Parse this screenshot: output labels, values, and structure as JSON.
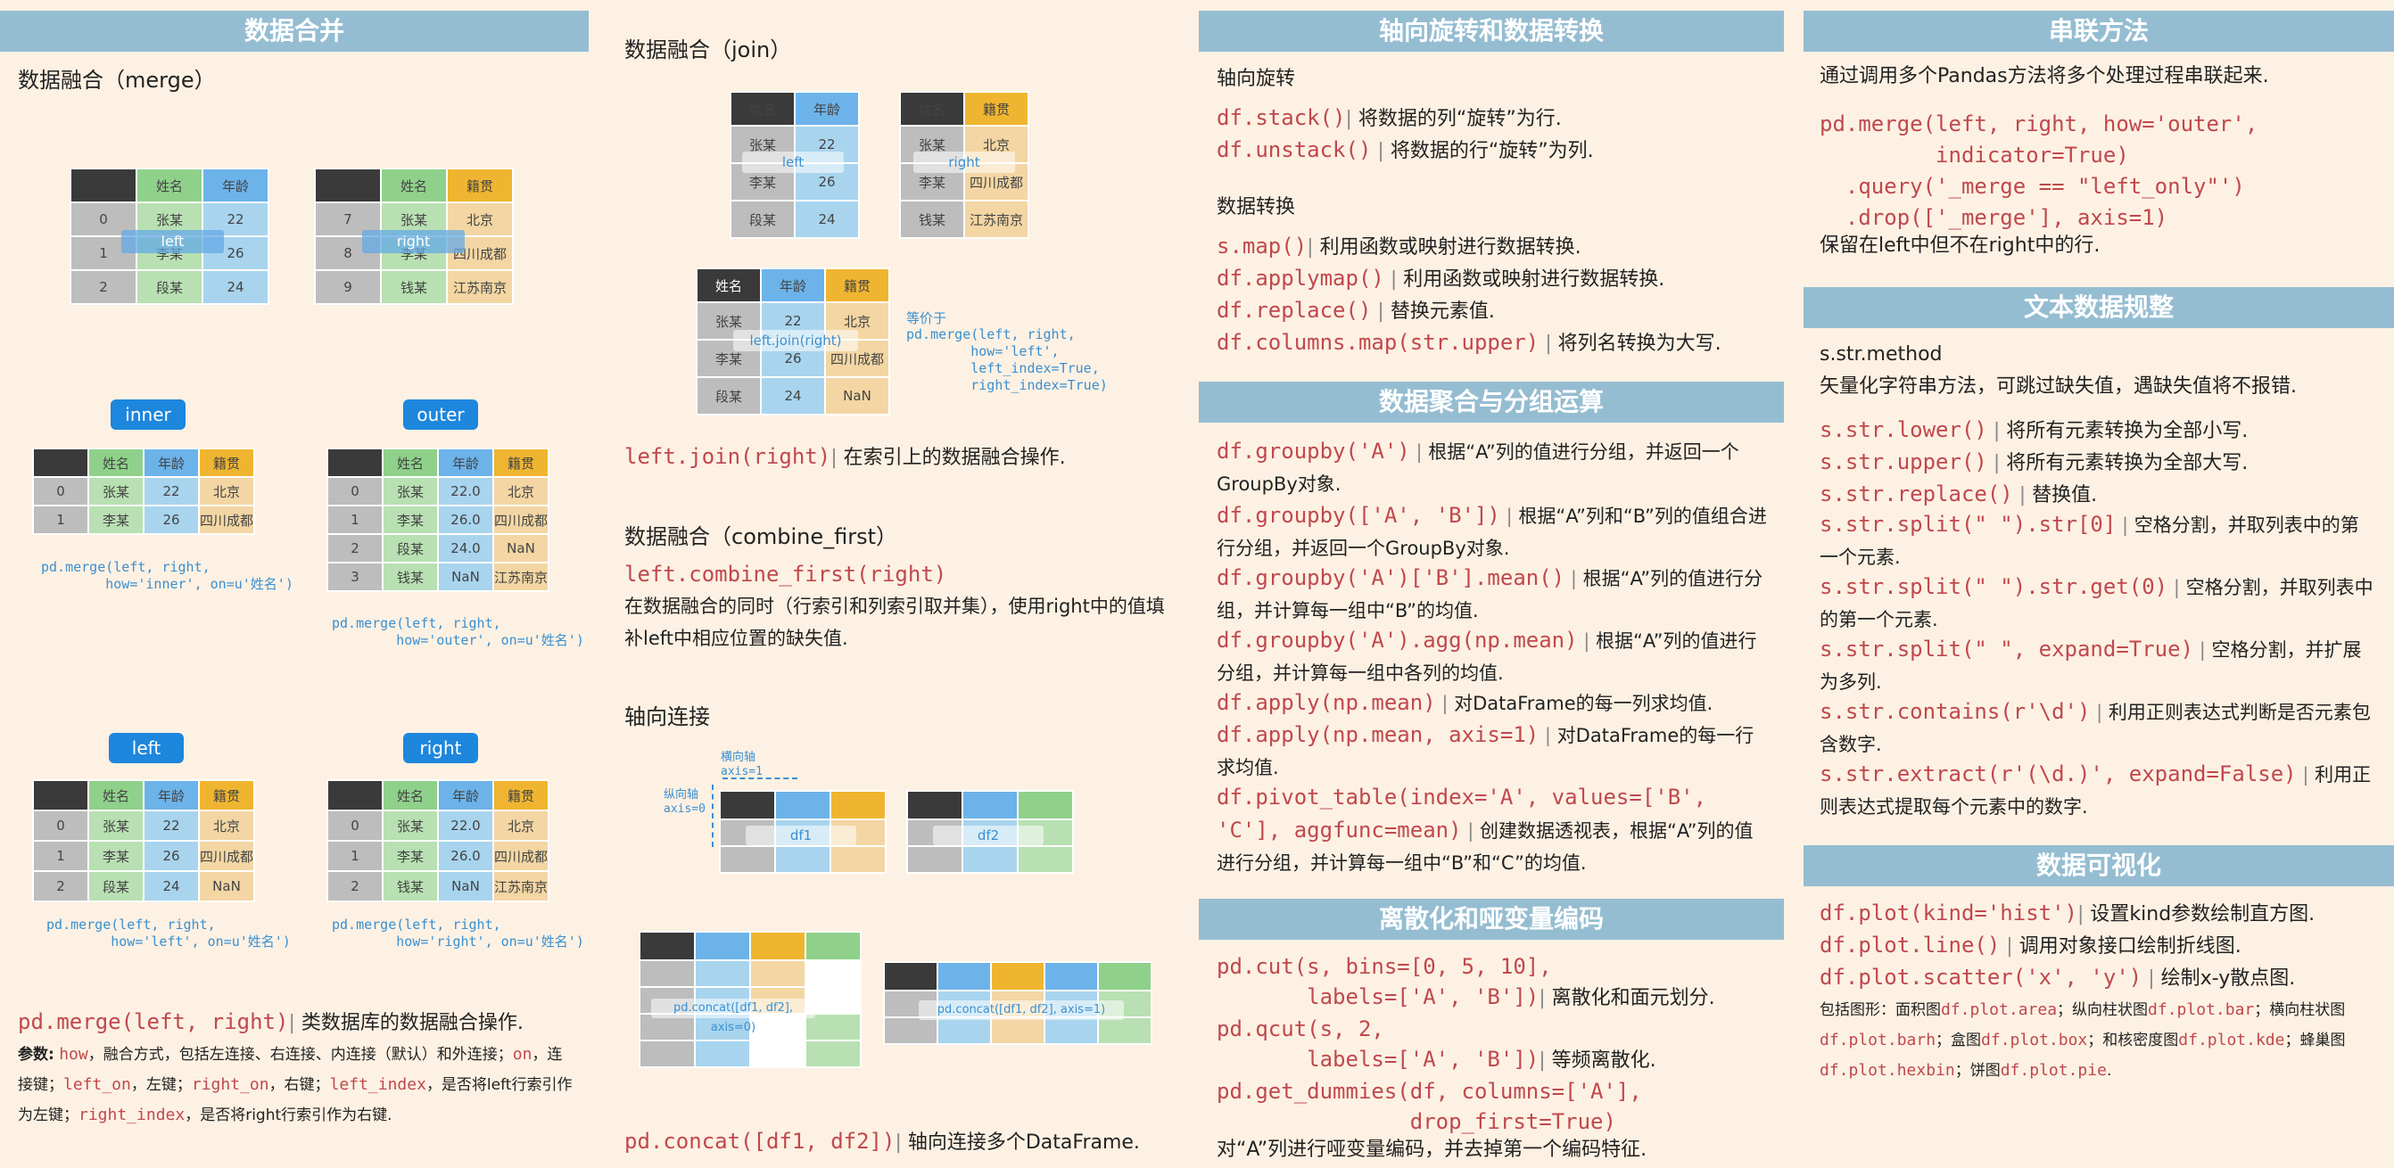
{
  "col1": {
    "header": "数据合并",
    "merge_title": "数据融合（merge）",
    "tbl_headers": [
      "姓名",
      "年龄",
      "籍贯"
    ],
    "left_rows": [
      [
        "0",
        "张某",
        "22"
      ],
      [
        "1",
        "李某",
        "26"
      ],
      [
        "2",
        "段某",
        "24"
      ]
    ],
    "right_rows": [
      [
        "7",
        "张某",
        "北京"
      ],
      [
        "8",
        "李某",
        "四川成都"
      ],
      [
        "9",
        "钱某",
        "江苏南京"
      ]
    ],
    "label_left": "left",
    "label_right": "right",
    "inner_label": "inner",
    "outer_label": "outer",
    "left_label": "left",
    "right_label": "right",
    "inner_rows": [
      [
        "0",
        "张某",
        "22",
        "北京"
      ],
      [
        "1",
        "李某",
        "26",
        "四川成都"
      ]
    ],
    "outer_rows": [
      [
        "0",
        "张某",
        "22.0",
        "北京"
      ],
      [
        "1",
        "李某",
        "26.0",
        "四川成都"
      ],
      [
        "2",
        "段某",
        "24.0",
        "NaN"
      ],
      [
        "3",
        "钱某",
        "NaN",
        "江苏南京"
      ]
    ],
    "lefth_rows": [
      [
        "0",
        "张某",
        "22",
        "北京"
      ],
      [
        "1",
        "李某",
        "26",
        "四川成都"
      ],
      [
        "2",
        "段某",
        "24",
        "NaN"
      ]
    ],
    "righth_rows": [
      [
        "0",
        "张某",
        "22.0",
        "北京"
      ],
      [
        "1",
        "李某",
        "26.0",
        "四川成都"
      ],
      [
        "2",
        "钱某",
        "NaN",
        "江苏南京"
      ]
    ],
    "inner_cap": "pd.merge(left, right,\n        how='inner', on=u'姓名')",
    "outer_cap": "pd.merge(left, right,\n        how='outer', on=u'姓名')",
    "left_cap": "pd.merge(left, right,\n        how='left', on=u'姓名')",
    "right_cap": "pd.merge(left, right,\n        how='right', on=u'姓名')",
    "merge_code": "pd.merge(left, right)",
    "merge_desc": "类数据库的数据融合操作.",
    "params_label": "参数:",
    "p_how": "how",
    "p_how_desc": "，融合方式，包括左连接、右连接、内连接（默认）和外连接；",
    "p_on": "on",
    "p_on_desc": "，连接键；",
    "p_left_on": "left_on",
    "p_left_on_desc": "，左键；",
    "p_right_on": "right_on",
    "p_right_on_desc": "，右键；",
    "p_left_index": "left_index",
    "p_left_index_desc": "，是否将left行索引作为左键；",
    "p_right_index": "right_index",
    "p_right_index_desc": "，是否将right行索引作为右键."
  },
  "col2": {
    "join_title": "数据融合（join）",
    "join_left_rows": [
      [
        "张某",
        "22"
      ],
      [
        "李某",
        "26"
      ],
      [
        "段某",
        "24"
      ]
    ],
    "join_right_rows": [
      [
        "张某",
        "北京"
      ],
      [
        "李某",
        "四川成都"
      ],
      [
        "钱某",
        "江苏南京"
      ]
    ],
    "join_res_rows": [
      [
        "张某",
        "22",
        "北京"
      ],
      [
        "李某",
        "26",
        "四川成都"
      ],
      [
        "段某",
        "24",
        "NaN"
      ]
    ],
    "join_ovl": "left.join(right)",
    "join_note1": "等价于",
    "join_note2": "pd.merge(left, right,\n        how='left',\n        left_index=True,\n        right_index=True)",
    "join_code": "left.join(right)",
    "join_desc": "在索引上的数据融合操作.",
    "cf_title": "数据融合（combine_first）",
    "cf_code": "left.combine_first(right)",
    "cf_desc": "在数据融合的同时（行索引和列索引取并集），使用right中的值填补left中相应位置的缺失值.",
    "concat_title": "轴向连接",
    "axis1_label": "横向轴\naxis=1",
    "axis0_label": "纵向轴\naxis=0",
    "df1": "df1",
    "df2": "df2",
    "concat0": "pd.concat([df1, df2], axis=0)",
    "concat1": "pd.concat([df1, df2], axis=1)",
    "concat_code": "pd.concat([df1, df2])",
    "concat_desc": "轴向连接多个DataFrame."
  },
  "col3": {
    "header1": "轴向旋转和数据转换",
    "rot_title": "轴向旋转",
    "stack_code": "df.stack()",
    "stack_desc": "将数据的列“旋转”为行.",
    "unstack_code": "df.unstack()",
    "unstack_desc": "将数据的行“旋转”为列.",
    "conv_title": "数据转换",
    "map_code": "s.map()",
    "map_desc": "利用函数或映射进行数据转换.",
    "applymap_code": "df.applymap()",
    "applymap_desc": "利用函数或映射进行数据转换.",
    "replace_code": "df.replace()",
    "replace_desc": "替换元素值.",
    "colmap_code": "df.columns.map(str.upper)",
    "colmap_desc": "将列名转换为大写.",
    "header2": "数据聚合与分组运算",
    "g1_code": "df.groupby('A')",
    "g1_desc": "根据“A”列的值进行分组，并返回一个GroupBy对象.",
    "g2_code": "df.groupby(['A', 'B'])",
    "g2_desc": "根据“A”列和“B”列的值组合进行分组，并返回一个GroupBy对象.",
    "g3_code": "df.groupby('A')['B'].mean()",
    "g3_desc": "根据“A”列的值进行分组，并计算每一组中“B”的均值.",
    "g4_code": "df.groupby('A').agg(np.mean)",
    "g4_desc": "根据“A”列的值进行分组，并计算每一组中各列的均值.",
    "a1_code": "df.apply(np.mean)",
    "a1_desc": "对DataFrame的每一列求均值.",
    "a2_code": "df.apply(np.mean, axis=1)",
    "a2_desc": "对DataFrame的每一行求均值.",
    "pv_code": "df.pivot_table(index='A', values=['B', 'C'], aggfunc=mean)",
    "pv_desc": "创建数据透视表，根据“A”列的值进行分组，并计算每一组中“B”和“C”的均值.",
    "header3": "离散化和哑变量编码",
    "cut_code1": "pd.cut(s, bins=[0, 5, 10],",
    "cut_code2": "       labels=['A', 'B'])",
    "cut_desc": "离散化和面元划分.",
    "qcut_code1": "pd.qcut(s, 2,",
    "qcut_code2": "       labels=['A', 'B'])",
    "qcut_desc": "等频离散化.",
    "dum_code1": "pd.get_dummies(df, columns=['A'],",
    "dum_code2": "               drop_first=True)",
    "dum_desc": "对“A”列进行哑变量编码，并去掉第一个编码特征."
  },
  "col4": {
    "header1": "串联方法",
    "chain_desc": "通过调用多个Pandas方法将多个处理过程串联起来.",
    "chain_code": "pd.merge(left, right, how='outer',\n         indicator=True)\n  .query('_merge == \"left_only\"')\n  .drop(['_merge'], axis=1)",
    "chain_note": "保留在left中但不在right中的行.",
    "header2": "文本数据规整",
    "str_title": "s.str.method",
    "str_desc": "矢量化字符串方法，可跳过缺失值，遇缺失值将不报错.",
    "s1_code": "s.str.lower()",
    "s1_desc": "将所有元素转换为全部小写.",
    "s2_code": "s.str.upper()",
    "s2_desc": "将所有元素转换为全部大写.",
    "s3_code": "s.str.replace()",
    "s3_desc": "替换值.",
    "s4_code": "s.str.split(\" \").str[0]",
    "s4_desc": "空格分割，并取列表中的第一个元素.",
    "s5_code": "s.str.split(\" \").str.get(0)",
    "s5_desc": "空格分割，并取列表中的第一个元素.",
    "s6_code": "s.str.split(\" \", expand=True)",
    "s6_desc": "空格分割，并扩展为多列.",
    "s7_code": "s.str.contains(r'\\d')",
    "s7_desc": "利用正则表达式判断是否元素包含数字.",
    "s8_code": "s.str.extract(r'(\\d.)', expand=False)",
    "s8_desc": "利用正则表达式提取每个元素中的数字.",
    "header3": "数据可视化",
    "v1_code": "df.plot(kind='hist')",
    "v1_desc": "设置kind参数绘制直方图.",
    "v2_code": "df.plot.line()",
    "v2_desc": "调用对象接口绘制折线图.",
    "v3_code": "df.plot.scatter('x', 'y')",
    "v3_desc": "绘制x-y散点图.",
    "more_label": "包括图形：面积图",
    "m1": "df.plot.area",
    "m1d": "；纵向柱状图",
    "m2": "df.plot.bar",
    "m2d": "；横向柱状图",
    "m3": "df.plot.barh",
    "m3d": "；盒图",
    "m4": "df.plot.box",
    "m4d": "；和核密度图",
    "m5": "df.plot.kde",
    "m5d": "；蜂巢图",
    "m6": "df.plot.hexbin",
    "m6d": "；饼图",
    "m7": "df.plot.pie",
    "m7d": "."
  }
}
